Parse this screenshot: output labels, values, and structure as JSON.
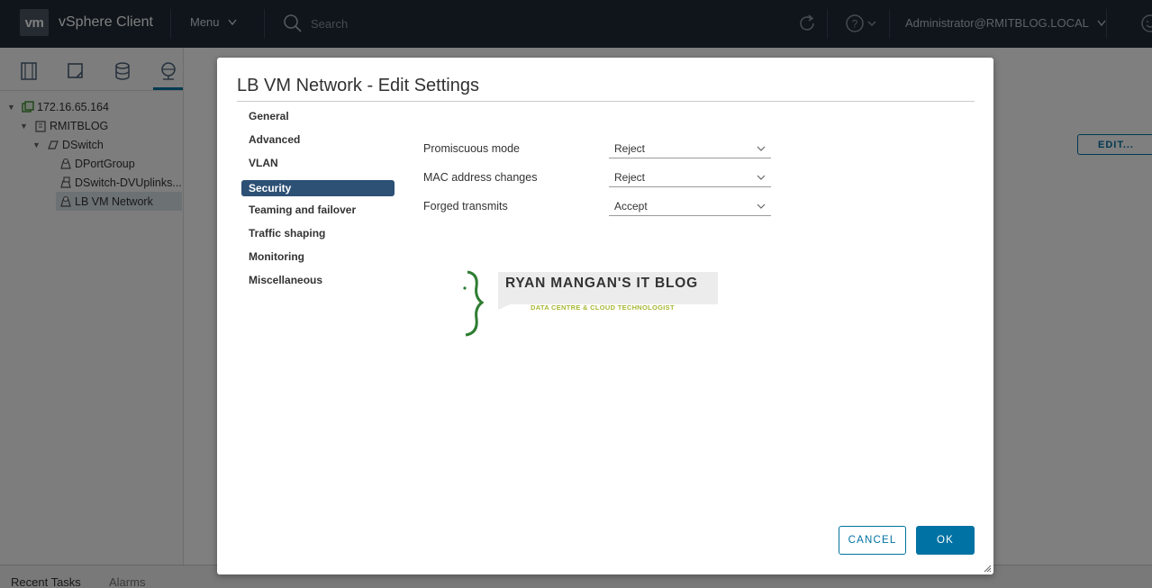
{
  "header": {
    "logo_text": "vm",
    "app_title": "vSphere Client",
    "menu_label": "Menu",
    "search_placeholder": "Search",
    "user_label": "Administrator@RMITBLOG.LOCAL",
    "icons": [
      "search-icon",
      "refresh-icon",
      "help-icon",
      "user-feedback-icon"
    ]
  },
  "navigator": {
    "tabs": [
      "hosts-clusters-icon",
      "vms-templates-icon",
      "storage-icon",
      "networking-icon"
    ],
    "tree": [
      {
        "label": "172.16.65.164",
        "icon": "vcenter-icon",
        "level": 0,
        "expanded": true
      },
      {
        "label": "RMITBLOG",
        "icon": "datacenter-icon",
        "level": 1,
        "expanded": true
      },
      {
        "label": "DSwitch",
        "icon": "distributed-switch-icon",
        "level": 2,
        "expanded": true
      },
      {
        "label": "DPortGroup",
        "icon": "portgroup-icon",
        "level": 3
      },
      {
        "label": "DSwitch-DVUplinks...",
        "icon": "uplink-portgroup-icon",
        "level": 3
      },
      {
        "label": "LB VM Network",
        "icon": "portgroup-icon",
        "level": 3,
        "selected": true
      }
    ]
  },
  "main": {
    "edit_button": "EDIT..."
  },
  "bottom": {
    "recent_tasks": "Recent Tasks",
    "alarms": "Alarms"
  },
  "dialog": {
    "title": "LB VM Network - Edit Settings",
    "nav": [
      "General",
      "Advanced",
      "VLAN",
      "Security",
      "Teaming and failover",
      "Traffic shaping",
      "Monitoring",
      "Miscellaneous"
    ],
    "active_nav": "Security",
    "fields": [
      {
        "label": "Promiscuous mode",
        "value": "Reject"
      },
      {
        "label": "MAC address changes",
        "value": "Reject"
      },
      {
        "label": "Forged transmits",
        "value": "Accept"
      }
    ],
    "watermark": {
      "title": "RYAN MANGAN'S IT BLOG",
      "subtitle": "DATA CENTRE & CLOUD TECHNOLOGIST"
    },
    "cancel_label": "CANCEL",
    "ok_label": "OK"
  },
  "colors": {
    "header_bg": "#1f2a36",
    "accent": "#0072a3",
    "active_nav_bg": "#2d5075",
    "blog_green": "#a7b834"
  }
}
